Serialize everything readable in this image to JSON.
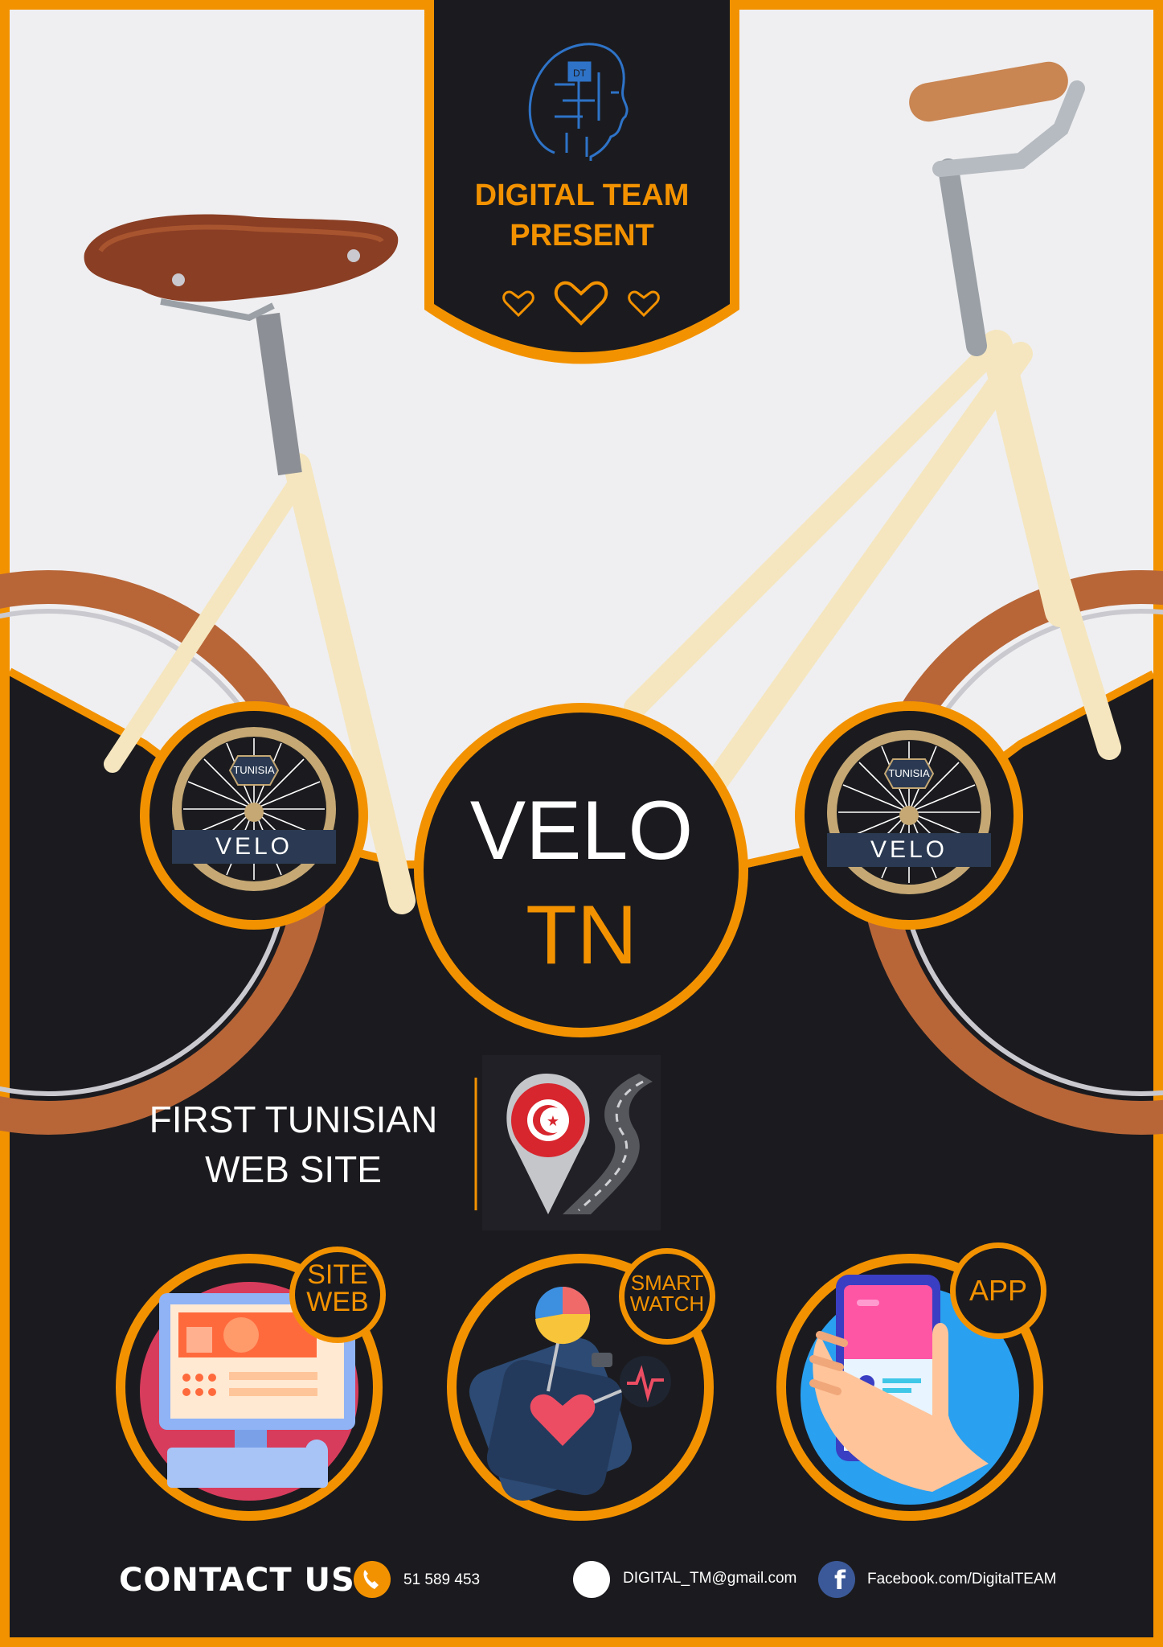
{
  "banner": {
    "title_line1": "DIGITAL TEAM",
    "title_line2": "PRESENT",
    "logo_initials": "DT"
  },
  "hero": {
    "word_top": "VELO",
    "word_bottom": "TN"
  },
  "badges": {
    "country": "TUNISIA",
    "label": "VELO"
  },
  "tagline": {
    "line1": "FIRST TUNISIAN",
    "line2": "WEB SITE"
  },
  "services": [
    {
      "line1": "SITE",
      "line2": "WEB"
    },
    {
      "line1": "SMART",
      "line2": "WATCH"
    },
    {
      "line1": "APP",
      "line2": ""
    }
  ],
  "contact": {
    "title": "CONTACT US:",
    "phone": "51 589 453",
    "email": "DIGITAL_TM@gmail.com",
    "facebook": "Facebook.com/DigitalTEAM"
  },
  "colors": {
    "accent": "#f39200",
    "dark": "#1b1b1f",
    "frame_cream": "#f5e6bf",
    "tire": "#b86638",
    "facebook": "#3b5998"
  }
}
